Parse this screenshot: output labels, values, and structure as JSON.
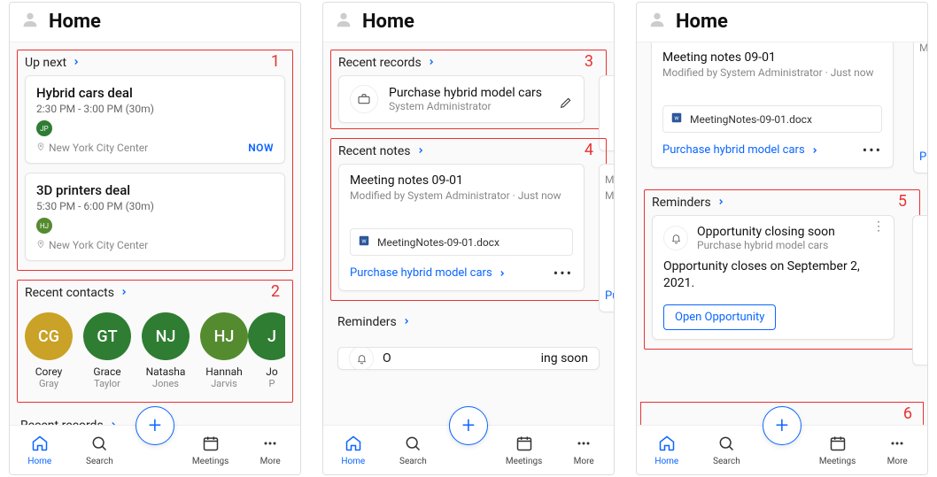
{
  "common": {
    "home_title": "Home",
    "nav": {
      "home": "Home",
      "search": "Search",
      "meetings": "Meetings",
      "more": "More",
      "fab": "+"
    }
  },
  "phone1": {
    "annotation_1": "1",
    "annotation_2": "2",
    "up_next": {
      "title": "Up next",
      "events": [
        {
          "title": "Hybrid cars deal",
          "time": "2:30 PM - 3:00 PM (30m)",
          "avatar_initials": "JP",
          "avatar_color": "#2E7D32",
          "location": "New York City Center",
          "now_label": "NOW"
        },
        {
          "title": "3D printers deal",
          "time": "5:30 PM - 6:00 PM (30m)",
          "avatar_initials": "HJ",
          "avatar_color": "#558B2F",
          "location": "New York City Center"
        }
      ]
    },
    "recent_contacts": {
      "title": "Recent contacts",
      "items": [
        {
          "initials": "CG",
          "first": "Corey",
          "last": "Gray",
          "color": "#C9A227"
        },
        {
          "initials": "GT",
          "first": "Grace",
          "last": "Taylor",
          "color": "#2E7D32"
        },
        {
          "initials": "NJ",
          "first": "Natasha",
          "last": "Jones",
          "color": "#2E7D32"
        },
        {
          "initials": "HJ",
          "first": "Hannah",
          "last": "Jarvis",
          "color": "#558B2F"
        },
        {
          "initials": "J",
          "first": "Jo",
          "last": "P",
          "color": "#2E7D32"
        }
      ]
    },
    "trailing_header": "Recent records"
  },
  "phone2": {
    "annotation_3": "3",
    "annotation_4": "4",
    "recent_records": {
      "title": "Recent records",
      "card": {
        "title": "Purchase hybrid model cars",
        "subtitle": "System Administrator"
      }
    },
    "recent_notes": {
      "title": "Recent notes",
      "card": {
        "title": "Meeting notes 09-01",
        "subtitle": "Modified by System Administrator · Just now",
        "attachment": "MeetingNotes-09-01.docx",
        "related": "Purchase hybrid model cars"
      },
      "peek_title_initial": "M",
      "peek_sub_initial": "M",
      "peek_related_initial": "Pu"
    },
    "reminders_header": "Reminders",
    "cut_reminder_fragments": {
      "left": "O",
      "right": "ing soon"
    }
  },
  "phone3": {
    "annotation_5": "5",
    "annotation_6": "6",
    "note_card": {
      "title": "Meeting notes 09-01",
      "subtitle": "Modified by System Administrator · Just now",
      "attachment": "MeetingNotes-09-01.docx",
      "related": "Purchase hybrid model cars"
    },
    "note_peek_initial": "M",
    "note_peek_related": "P",
    "reminders": {
      "title": "Reminders",
      "card": {
        "title": "Opportunity closing soon",
        "subtitle": "Purchase hybrid model cars",
        "body": "Opportunity closes on September 2, 2021.",
        "button": "Open Opportunity"
      }
    }
  }
}
